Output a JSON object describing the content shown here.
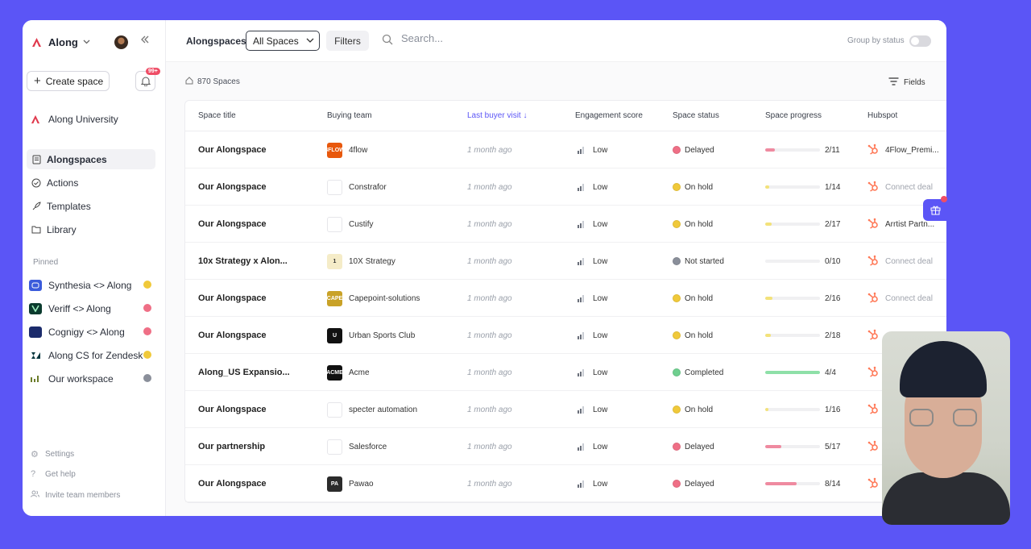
{
  "sidebar": {
    "workspace": "Along",
    "create_label": "Create space",
    "notification_badge": "99+",
    "university": "Along University",
    "nav": [
      {
        "label": "Alongspaces",
        "icon": "document-icon",
        "active": true
      },
      {
        "label": "Actions",
        "icon": "check-circle-icon",
        "active": false
      },
      {
        "label": "Templates",
        "icon": "rocket-icon",
        "active": false
      },
      {
        "label": "Library",
        "icon": "folder-icon",
        "active": false
      }
    ],
    "pinned_label": "Pinned",
    "pinned": [
      {
        "label": "Synthesia <> Along",
        "logo_color": "#3b5bdb",
        "dot": "#f0c93a"
      },
      {
        "label": "Veriff <> Along",
        "logo_color": "#0b3b2e",
        "dot": "#ef6f86"
      },
      {
        "label": "Cognigy <> Along",
        "logo_color": "#1b2b6b",
        "dot": "#ef6f86"
      },
      {
        "label": "Along CS for Zendesk",
        "logo_color": "#ffffff",
        "dot": "#f0c93a"
      },
      {
        "label": "Our workspace",
        "logo_color": "#ffffff",
        "dot": "#8a8f9a"
      }
    ],
    "footer": {
      "settings": "Settings",
      "help": "Get help",
      "invite": "Invite team members"
    }
  },
  "topbar": {
    "breadcrumb": "Alongspaces",
    "filter_select": "All Spaces",
    "filters_label": "Filters",
    "search_placeholder": "Search...",
    "group_label": "Group by status"
  },
  "list": {
    "count": "870 Spaces",
    "fields_label": "Fields"
  },
  "table": {
    "columns": [
      "Space title",
      "Buying team",
      "Last buyer visit",
      "Engagement score",
      "Space status",
      "Space progress",
      "Hubspot"
    ],
    "rows": [
      {
        "title": "Our Alongspace",
        "team": "4flow",
        "logo": "#e8580c",
        "logo_text": "4FLOW",
        "visit": "1 month ago",
        "eng": "Low",
        "status": "Delayed",
        "dot": "#ef6f86",
        "progress": "2/11",
        "fill": 0.18,
        "fill_color": "#ef8aa0",
        "hub": "4Flow_Premi...",
        "hub_muted": false
      },
      {
        "title": "Our Alongspace",
        "team": "Constrafor",
        "logo": "#ffffff",
        "logo_text": "",
        "visit": "1 month ago",
        "eng": "Low",
        "status": "On hold",
        "dot": "#f0c93a",
        "progress": "1/14",
        "fill": 0.07,
        "fill_color": "#f3e27a",
        "hub": "Connect deal",
        "hub_muted": true
      },
      {
        "title": "Our Alongspace",
        "team": "Custify",
        "logo": "#ffffff",
        "logo_text": "",
        "visit": "1 month ago",
        "eng": "Low",
        "status": "On hold",
        "dot": "#f0c93a",
        "progress": "2/17",
        "fill": 0.12,
        "fill_color": "#f3e27a",
        "hub": "Arrtist Partn...",
        "hub_muted": false
      },
      {
        "title": "10x Strategy x Alon...",
        "team": "10X Strategy",
        "logo": "#f5ecc8",
        "logo_text": "1",
        "visit": "1 month ago",
        "eng": "Low",
        "status": "Not started",
        "dot": "#8a8f9a",
        "progress": "0/10",
        "fill": 0,
        "fill_color": "#cccccc",
        "hub": "Connect deal",
        "hub_muted": true
      },
      {
        "title": "Our Alongspace",
        "team": "Capepoint-solutions",
        "logo": "#c9a227",
        "logo_text": "CAPE",
        "visit": "1 month ago",
        "eng": "Low",
        "status": "On hold",
        "dot": "#f0c93a",
        "progress": "2/16",
        "fill": 0.13,
        "fill_color": "#f3e27a",
        "hub": "Connect deal",
        "hub_muted": true
      },
      {
        "title": "Our Alongspace",
        "team": "Urban Sports Club",
        "logo": "#111111",
        "logo_text": "U",
        "visit": "1 month ago",
        "eng": "Low",
        "status": "On hold",
        "dot": "#f0c93a",
        "progress": "2/18",
        "fill": 0.11,
        "fill_color": "#f3e27a",
        "hub": "",
        "hub_muted": true
      },
      {
        "title": "Along_US Expansio...",
        "team": "Acme",
        "logo": "#111111",
        "logo_text": "ACME",
        "visit": "1 month ago",
        "eng": "Low",
        "status": "Completed",
        "dot": "#6fcf8f",
        "progress": "4/4",
        "fill": 1,
        "fill_color": "#8ee0a8",
        "hub": "",
        "hub_muted": true
      },
      {
        "title": "Our Alongspace",
        "team": "specter automation",
        "logo": "#ffffff",
        "logo_text": "",
        "visit": "1 month ago",
        "eng": "Low",
        "status": "On hold",
        "dot": "#f0c93a",
        "progress": "1/16",
        "fill": 0.06,
        "fill_color": "#f3e27a",
        "hub": "",
        "hub_muted": true
      },
      {
        "title": "Our partnership",
        "team": "Salesforce",
        "logo": "#ffffff",
        "logo_text": "",
        "visit": "1 month ago",
        "eng": "Low",
        "status": "Delayed",
        "dot": "#ef6f86",
        "progress": "5/17",
        "fill": 0.29,
        "fill_color": "#ef8aa0",
        "hub": "",
        "hub_muted": true
      },
      {
        "title": "Our Alongspace",
        "team": "Pawao",
        "logo": "#2b2b2b",
        "logo_text": "PA",
        "visit": "1 month ago",
        "eng": "Low",
        "status": "Delayed",
        "dot": "#ef6f86",
        "progress": "8/14",
        "fill": 0.57,
        "fill_color": "#ef8aa0",
        "hub": "",
        "hub_muted": true
      }
    ]
  }
}
